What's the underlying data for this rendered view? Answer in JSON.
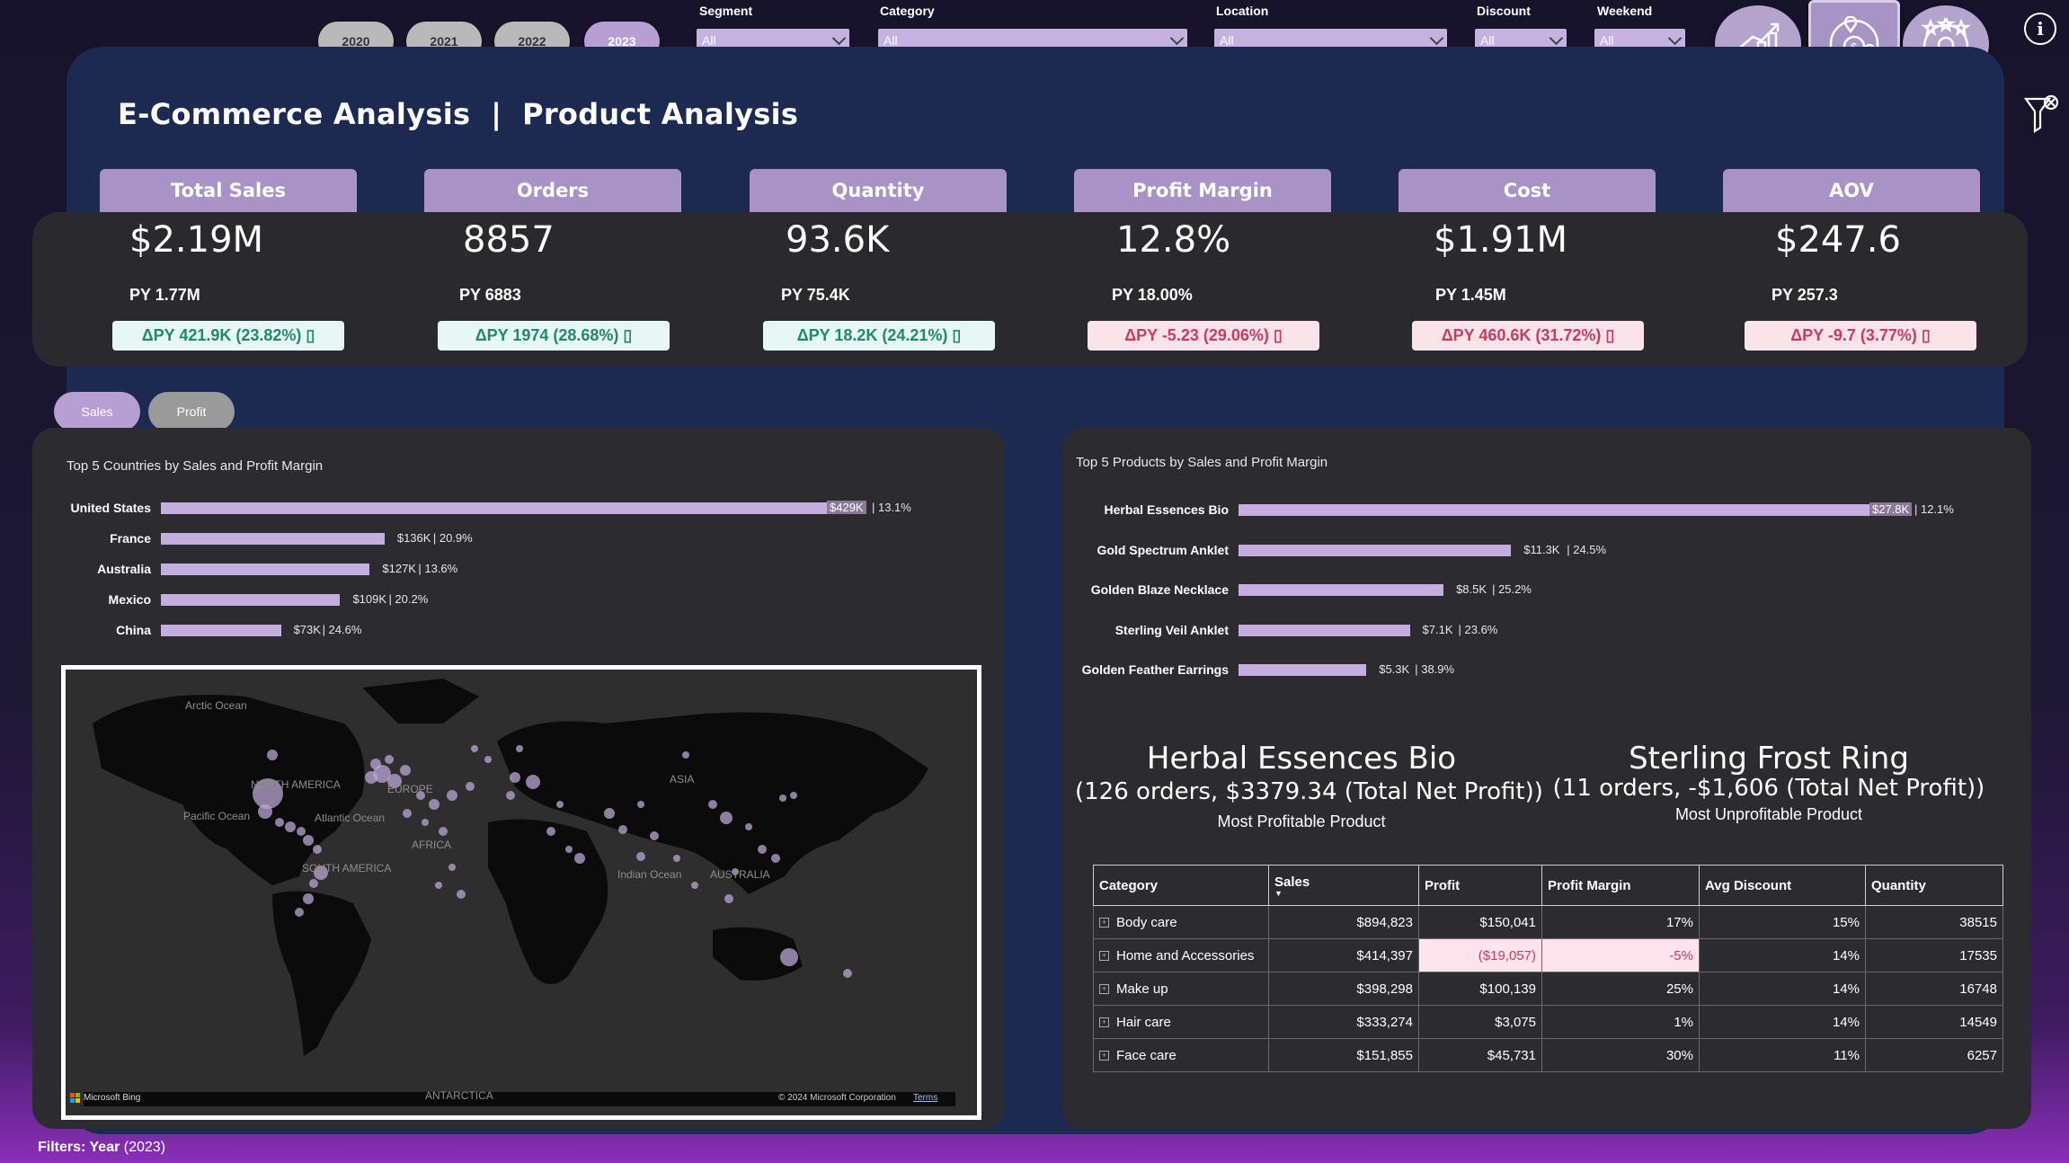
{
  "years": [
    "2020",
    "2021",
    "2022",
    "2023"
  ],
  "slicers": {
    "segment": {
      "label": "Segment",
      "value": "All"
    },
    "category": {
      "label": "Category",
      "value": "All"
    },
    "location": {
      "label": "Location",
      "value": "All"
    },
    "discount": {
      "label": "Discount",
      "value": "All"
    },
    "weekend": {
      "label": "Weekend",
      "value": "All"
    }
  },
  "nav_icons": [
    "chart-growth-icon",
    "money-location-icon",
    "customer-rating-icon"
  ],
  "title": "E-Commerce Analysis  |  Product Analysis",
  "kpis": [
    {
      "label": "Total Sales",
      "value": "$2.19M",
      "py": "PY 1.77M",
      "delta": "ΔPY 421.9K (23.82%) ▯",
      "trend": "up"
    },
    {
      "label": "Orders",
      "value": "8857",
      "py": "PY 6883",
      "delta": "ΔPY 1974 (28.68%) ▯",
      "trend": "up"
    },
    {
      "label": "Quantity",
      "value": "93.6K",
      "py": "PY 75.4K",
      "delta": "ΔPY 18.2K (24.21%) ▯",
      "trend": "up"
    },
    {
      "label": "Profit Margin",
      "value": "12.8%",
      "py": "PY 18.00%",
      "delta": "ΔPY -5.23 (29.06%) ▯",
      "trend": "down"
    },
    {
      "label": "Cost",
      "value": "$1.91M",
      "py": "PY 1.45M",
      "delta": "ΔPY 460.6K (31.72%) ▯",
      "trend": "down"
    },
    {
      "label": "AOV",
      "value": "$247.6",
      "py": "PY 257.3",
      "delta": "ΔPY -9.7 (3.77%) ▯",
      "trend": "down"
    }
  ],
  "toggles": {
    "sales": "Sales",
    "profit": "Profit",
    "active": "Sales"
  },
  "countries_chart": {
    "title": "Top 5 Countries by Sales and Profit Margin",
    "rows": [
      {
        "name": "United States",
        "sales": 429,
        "label": "$429K",
        "margin": "| 13.1%"
      },
      {
        "name": "France",
        "sales": 136,
        "label": "$136K",
        "margin": "| 20.9%"
      },
      {
        "name": "Australia",
        "sales": 127,
        "label": "$127K",
        "margin": "| 13.6%"
      },
      {
        "name": "Mexico",
        "sales": 109,
        "label": "$109K",
        "margin": "| 20.2%"
      },
      {
        "name": "China",
        "sales": 73,
        "label": "$73K",
        "margin": "| 24.6%"
      }
    ]
  },
  "map": {
    "labels": {
      "arctic": "Arctic Ocean",
      "north_america": "NORTH AMERICA",
      "europe": "EUROPE",
      "asia": "ASIA",
      "pacific": "Pacific Ocean",
      "atlantic": "Atlantic Ocean",
      "africa": "AFRICA",
      "south_america": "SOUTH AMERICA",
      "indian": "Indian Ocean",
      "australia": "AUSTRALIA",
      "antarctica": "ANTARCTICA"
    },
    "bing": "Microsoft Bing",
    "copyright": "© 2024 Microsoft Corporation",
    "terms": "Terms"
  },
  "products_chart": {
    "title": "Top 5 Products by Sales and Profit Margin",
    "rows": [
      {
        "name": "Herbal Essences Bio",
        "sales": 27.8,
        "label": "$27.8K",
        "margin": "| 12.1%"
      },
      {
        "name": "Gold Spectrum Anklet",
        "sales": 11.3,
        "label": "$11.3K",
        "margin": "| 24.5%"
      },
      {
        "name": "Golden Blaze Necklace",
        "sales": 8.5,
        "label": "$8.5K",
        "margin": "| 25.2%"
      },
      {
        "name": "Sterling Veil Anklet",
        "sales": 7.1,
        "label": "$7.1K",
        "margin": "| 23.6%"
      },
      {
        "name": "Golden Feather Earrings",
        "sales": 5.3,
        "label": "$5.3K",
        "margin": "| 38.9%"
      }
    ]
  },
  "highlights": {
    "best": {
      "name": "Herbal Essences Bio",
      "detail": "(126 orders, $3379.34 (Total Net Profit))",
      "caption": "Most Profitable Product"
    },
    "worst": {
      "name": "Sterling Frost Ring",
      "detail": "(11 orders, -$1,606 (Total Net Profit))",
      "caption": "Most Unprofitable Product"
    }
  },
  "table": {
    "headers": [
      "Category",
      "Sales",
      "Profit",
      "Profit Margin",
      "Avg Discount",
      "Quantity"
    ],
    "rows": [
      {
        "category": "Body care",
        "sales": "$894,823",
        "profit": "$150,041",
        "margin": "17%",
        "discount": "15%",
        "quantity": "38515",
        "negative": false
      },
      {
        "category": "Home and Accessories",
        "sales": "$414,397",
        "profit": "($19,057)",
        "margin": "-5%",
        "discount": "14%",
        "quantity": "17535",
        "negative": true
      },
      {
        "category": "Make up",
        "sales": "$398,298",
        "profit": "$100,139",
        "margin": "25%",
        "discount": "14%",
        "quantity": "16748",
        "negative": false
      },
      {
        "category": "Hair care",
        "sales": "$333,274",
        "profit": "$3,075",
        "margin": "1%",
        "discount": "14%",
        "quantity": "14549",
        "negative": false
      },
      {
        "category": "Face care",
        "sales": "$151,855",
        "profit": "$45,731",
        "margin": "30%",
        "discount": "11%",
        "quantity": "6257",
        "negative": false
      }
    ]
  },
  "footer": {
    "label": "Filters: Year",
    "value": "(2023)"
  }
}
